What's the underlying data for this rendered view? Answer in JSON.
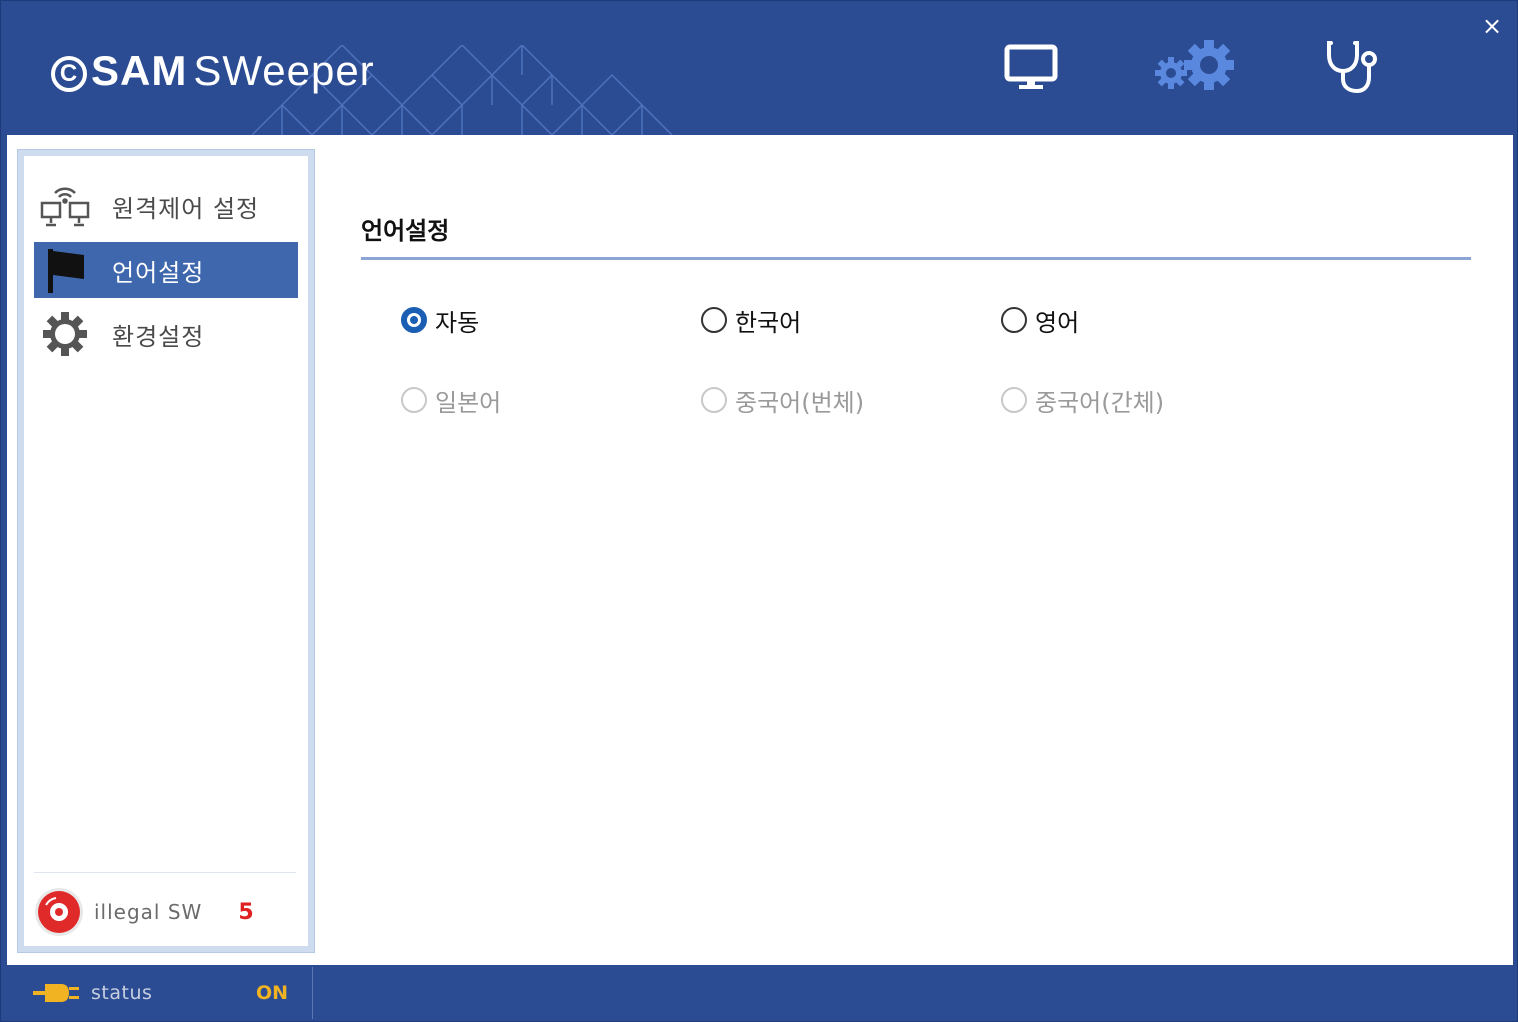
{
  "app": {
    "logo_mark": "C",
    "logo_sam": "SAM",
    "logo_sweeper": "SWeeper",
    "close_symbol": "×"
  },
  "header_icons": [
    {
      "name": "monitor-icon"
    },
    {
      "name": "gears-icon"
    },
    {
      "name": "stethoscope-icon"
    }
  ],
  "sidebar": {
    "items": [
      {
        "label": "원격제어 설정",
        "icon": "remote-network-icon",
        "active": false
      },
      {
        "label": "언어설정",
        "icon": "flag-icon",
        "active": true
      },
      {
        "label": "환경설정",
        "icon": "gear-icon",
        "active": false
      }
    ],
    "illegal_label": "illegal  SW",
    "illegal_count": "5"
  },
  "main": {
    "section_title": "언어설정",
    "languages": [
      {
        "label": "자동",
        "checked": true,
        "disabled": false
      },
      {
        "label": "한국어",
        "checked": false,
        "disabled": false
      },
      {
        "label": "영어",
        "checked": false,
        "disabled": false
      },
      {
        "label": "일본어",
        "checked": false,
        "disabled": true
      },
      {
        "label": "중국어(번체)",
        "checked": false,
        "disabled": true
      },
      {
        "label": "중국어(간체)",
        "checked": false,
        "disabled": true
      }
    ]
  },
  "statusbar": {
    "label": "status",
    "value": "ON"
  },
  "colors": {
    "header_bg": "#2b4c93",
    "accent": "#3e67ad",
    "radio_checked": "#1a5fb4",
    "status_on": "#f2b323",
    "illegal_count": "#e02020"
  }
}
